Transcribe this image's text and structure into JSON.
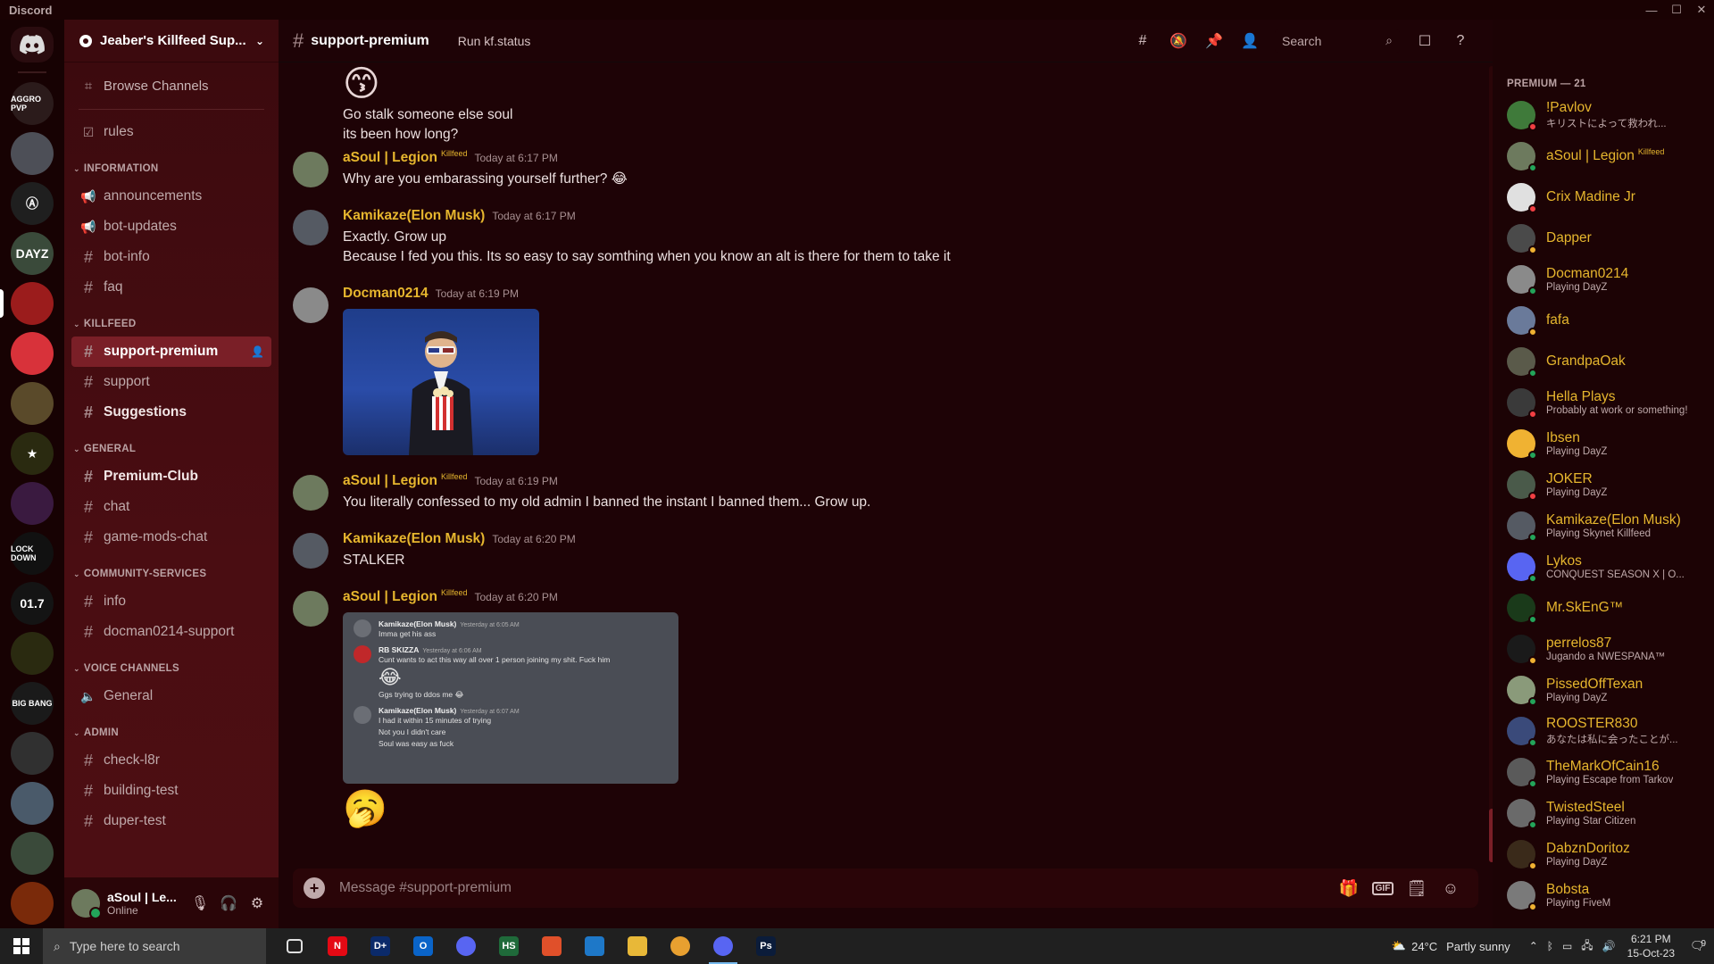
{
  "window": {
    "title": "Discord"
  },
  "guild": {
    "name": "Jeaber's Killfeed Sup..."
  },
  "sidebar": {
    "browse_label": "Browse Channels",
    "top_channels": [
      {
        "name": "rules",
        "icon": "rules-checkbox-icon"
      }
    ],
    "categories": [
      {
        "name": "INFORMATION",
        "channels": [
          {
            "name": "announcements",
            "icon": "megaphone-icon"
          },
          {
            "name": "bot-updates",
            "icon": "megaphone-icon"
          },
          {
            "name": "bot-info",
            "icon": "hash-icon"
          },
          {
            "name": "faq",
            "icon": "hash-icon"
          }
        ]
      },
      {
        "name": "KILLFEED",
        "channels": [
          {
            "name": "support-premium",
            "icon": "hash-icon",
            "active": true
          },
          {
            "name": "support",
            "icon": "hash-icon"
          },
          {
            "name": "Suggestions",
            "icon": "hash-icon",
            "bold": true
          }
        ]
      },
      {
        "name": "GENERAL",
        "channels": [
          {
            "name": "Premium-Club",
            "icon": "hash-icon",
            "bold": true
          },
          {
            "name": "chat",
            "icon": "hash-icon"
          },
          {
            "name": "game-mods-chat",
            "icon": "hash-icon"
          }
        ]
      },
      {
        "name": "COMMUNITY-SERVICES",
        "channels": [
          {
            "name": "info",
            "icon": "hash-icon"
          },
          {
            "name": "docman0214-support",
            "icon": "hash-icon"
          }
        ]
      },
      {
        "name": "VOICE CHANNELS",
        "channels": [
          {
            "name": "General",
            "icon": "speaker-icon"
          }
        ]
      },
      {
        "name": "ADMIN",
        "channels": [
          {
            "name": "check-l8r",
            "icon": "hash-icon"
          },
          {
            "name": "building-test",
            "icon": "hash-icon"
          },
          {
            "name": "duper-test",
            "icon": "hash-icon"
          }
        ]
      }
    ]
  },
  "user_panel": {
    "name": "aSoul | Le...",
    "status": "Online"
  },
  "rail": {
    "servers": [
      {
        "label": "AGGRO PVP",
        "color": "#2b1b1b"
      },
      {
        "label": "",
        "color": "#4d4f57"
      },
      {
        "label": "Ⓐ",
        "color": "#1f1f1f"
      },
      {
        "label": "DAYZ",
        "color": "#3a4a3a"
      },
      {
        "label": "",
        "color": "#9b1c1c",
        "active": true
      },
      {
        "label": "",
        "color": "#d8323a"
      },
      {
        "label": "",
        "color": "#5a4a2a"
      },
      {
        "label": "★",
        "color": "#2a2a10"
      },
      {
        "label": "",
        "color": "#3a1a40"
      },
      {
        "label": "LOCK DOWN",
        "color": "#111111"
      },
      {
        "label": "01.7",
        "color": "#141414"
      },
      {
        "label": "",
        "color": "#2a2a10"
      },
      {
        "label": "BIG BANG",
        "color": "#1a1a1a"
      },
      {
        "label": "",
        "color": "#303030"
      },
      {
        "label": "",
        "color": "#4a5a6a"
      },
      {
        "label": "",
        "color": "#3a4a3a"
      },
      {
        "label": "",
        "color": "#7a2a0a"
      }
    ]
  },
  "channel": {
    "name": "support-premium",
    "topic": "Run kf.status",
    "search_placeholder": "Search"
  },
  "messages": [
    {
      "type": "continuation",
      "emoji": "😙",
      "lines": [
        "Go stalk someone else soul",
        "its been how long?"
      ]
    },
    {
      "author": "aSoul | Legion",
      "tag": "Killfeed",
      "time": "Today at 6:17 PM",
      "lines": [
        "Why are you embarassing yourself further? 😂"
      ],
      "avatar_color": "#6d7a5e"
    },
    {
      "author": "Kamikaze(Elon Musk)",
      "time": "Today at 6:17 PM",
      "lines": [
        "Exactly. Grow up",
        "Because I fed you this. Its so easy to say somthing when you know an alt is there for them to take it"
      ],
      "avatar_color": "#555a63"
    },
    {
      "author": "Docman0214",
      "time": "Today at 6:19 PM",
      "lines": [],
      "attachment": "gif",
      "avatar_color": "#8a8a8a"
    },
    {
      "author": "aSoul | Legion",
      "tag": "Killfeed",
      "time": "Today at 6:19 PM",
      "lines": [
        "You literally confessed to my old admin I banned the instant I banned them... Grow up."
      ],
      "avatar_color": "#6d7a5e"
    },
    {
      "author": "Kamikaze(Elon Musk)",
      "time": "Today at 6:20 PM",
      "lines": [
        "STALKER"
      ],
      "avatar_color": "#555a63"
    },
    {
      "author": "aSoul | Legion",
      "tag": "Killfeed",
      "time": "Today at 6:20 PM",
      "lines": [],
      "attachment": "screenshot",
      "trailing_emoji": "🥱",
      "avatar_color": "#6d7a5e"
    }
  ],
  "screenshot": {
    "rows": [
      {
        "name": "Kamikaze(Elon Musk)",
        "time": "Yesterday at 6:05 AM",
        "lines": [
          "Imma get his ass"
        ]
      },
      {
        "name": "RB SKIZZA",
        "time": "Yesterday at 6:06 AM",
        "lines": [
          "Cunt wants to act this way all over 1 person joining my shit. Fuck him",
          "😂",
          "Ggs trying to ddos me 😂"
        ]
      },
      {
        "name": "Kamikaze(Elon Musk)",
        "time": "Yesterday at 6:07 AM",
        "lines": [
          "I had it within 15 minutes of trying",
          "Not you I didn't care",
          "Soul was easy as fuck"
        ]
      }
    ]
  },
  "composer": {
    "placeholder": "Message #support-premium",
    "gif_label": "GIF"
  },
  "members": {
    "heading": "PREMIUM — 21",
    "list": [
      {
        "name": "!Pavlov",
        "activity": "キリストによって救われ...",
        "color": "#3f7a3a",
        "status": "#f23f43"
      },
      {
        "name": "aSoul | Legion",
        "activity": "",
        "color": "#6d7a5e",
        "status": "#23a55a",
        "tag": "Killfeed"
      },
      {
        "name": "Crix Madine Jr",
        "activity": "",
        "color": "#e0e0e0",
        "status": "#f23f43"
      },
      {
        "name": "Dapper",
        "activity": "",
        "color": "#4a4a4a",
        "status": "#f0b232"
      },
      {
        "name": "Docman0214",
        "activity": "Playing DayZ",
        "color": "#8a8a8a",
        "status": "#23a55a"
      },
      {
        "name": "fafa",
        "activity": "",
        "color": "#6a7a9a",
        "status": "#f0b232"
      },
      {
        "name": "GrandpaOak",
        "activity": "",
        "color": "#5a5a4a",
        "status": "#23a55a"
      },
      {
        "name": "Hella Plays",
        "activity": "Probably at work or something!",
        "color": "#3a3a3a",
        "status": "#f23f43"
      },
      {
        "name": "Ibsen",
        "activity": "Playing DayZ",
        "color": "#f0b232",
        "status": "#23a55a"
      },
      {
        "name": "JOKER",
        "activity": "Playing DayZ",
        "color": "#4a5a4a",
        "status": "#f23f43"
      },
      {
        "name": "Kamikaze(Elon Musk)",
        "activity": "Playing Skynet Killfeed",
        "color": "#555a63",
        "status": "#23a55a"
      },
      {
        "name": "Lykos",
        "activity": "CONQUEST SEASON X | O...",
        "color": "#5865f2",
        "status": "#23a55a"
      },
      {
        "name": "Mr.SkEnG™",
        "activity": "",
        "color": "#1a3a1a",
        "status": "#23a55a"
      },
      {
        "name": "perrelos87",
        "activity": "Jugando a NWESPAÑA™",
        "color": "#1a1a1a",
        "status": "#f0b232"
      },
      {
        "name": "PissedOffTexan",
        "activity": "Playing DayZ",
        "color": "#8a9a7a",
        "status": "#23a55a"
      },
      {
        "name": "ROOSTER830",
        "activity": "あなたは私に会ったことが...",
        "color": "#3a4a7a",
        "status": "#23a55a"
      },
      {
        "name": "TheMarkOfCain16",
        "activity": "Playing Escape from Tarkov",
        "color": "#5a5a5a",
        "status": "#23a55a"
      },
      {
        "name": "TwistedSteel",
        "activity": "Playing Star Citizen",
        "color": "#6a6a6a",
        "status": "#23a55a"
      },
      {
        "name": "DabznDoritoz",
        "activity": "Playing DayZ",
        "color": "#3a2a1a",
        "status": "#f0b232"
      },
      {
        "name": "Bobsta",
        "activity": "Playing FiveM",
        "color": "#7a7a7a",
        "status": "#f0b232"
      }
    ]
  },
  "taskbar": {
    "search_placeholder": "Type here to search",
    "apps": [
      {
        "name": "task-view",
        "label": "",
        "color": "#202020"
      },
      {
        "name": "netflix",
        "label": "N",
        "color": "#e50914"
      },
      {
        "name": "disney-plus",
        "label": "D+",
        "color": "#0b2a6a"
      },
      {
        "name": "outlook",
        "label": "O",
        "color": "#0a64c8"
      },
      {
        "name": "discord-1",
        "label": "",
        "color": "#5865f2"
      },
      {
        "name": "hs",
        "label": "HS",
        "color": "#1f6a3a"
      },
      {
        "name": "app-orange",
        "label": "",
        "color": "#e0502a"
      },
      {
        "name": "vscode",
        "label": "",
        "color": "#1e78c8"
      },
      {
        "name": "file-explorer",
        "label": "",
        "color": "#e8b838"
      },
      {
        "name": "chrome",
        "label": "",
        "color": "#e8a030"
      },
      {
        "name": "discord-2",
        "label": "",
        "color": "#5865f2",
        "active": true
      },
      {
        "name": "photoshop",
        "label": "Ps",
        "color": "#0b1c3a"
      }
    ],
    "weather": {
      "temp": "24°C",
      "condition": "Partly sunny"
    },
    "clock": {
      "time": "6:21 PM",
      "date": "15-Oct-23"
    },
    "notification_count": "9"
  }
}
